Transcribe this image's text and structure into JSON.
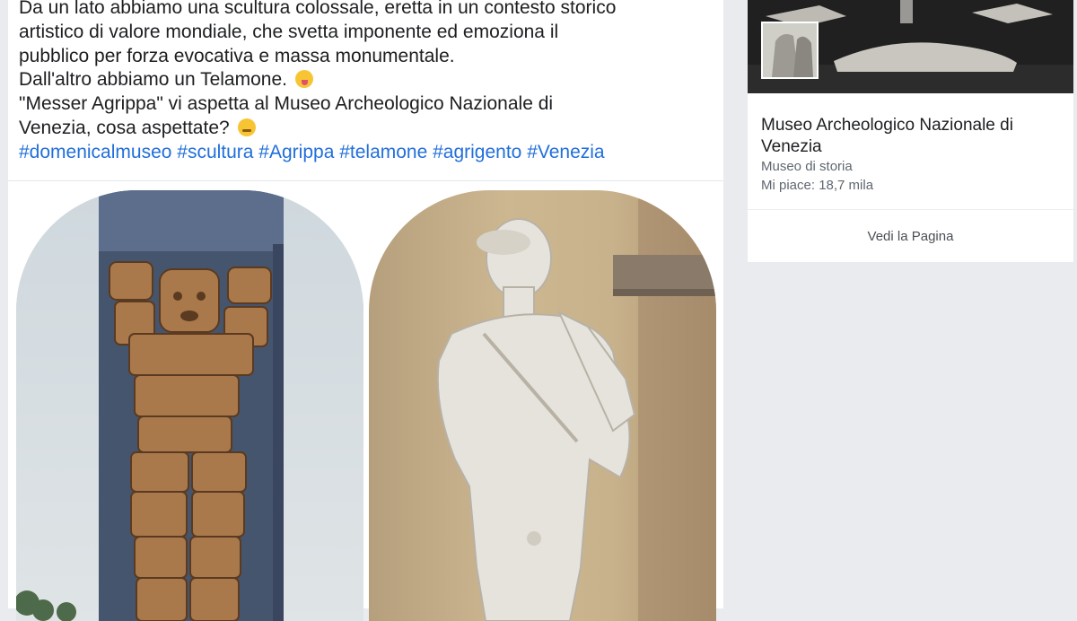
{
  "post": {
    "lines": [
      "Da un lato abbiamo una scultura colossale, eretta in un contesto storico",
      "artistico di valore mondiale, che svetta imponente ed emoziona il",
      "pubblico per forza evocativa e massa monumentale.",
      "Dall'altro abbiamo un Telamone.",
      "\"Messer Agrippa\" vi aspetta al Museo Archeologico Nazionale di",
      "Venezia, cosa aspettate?"
    ],
    "hashtags": "#domenicalmuseo #scultura #Agrippa #telamone #agrigento #Venezia"
  },
  "page_card": {
    "name": "Museo Archeologico Nazionale di Venezia",
    "category": "Museo di storia",
    "likes": "Mi piace: 18,7 mila",
    "view_page": "Vedi la Pagina"
  }
}
